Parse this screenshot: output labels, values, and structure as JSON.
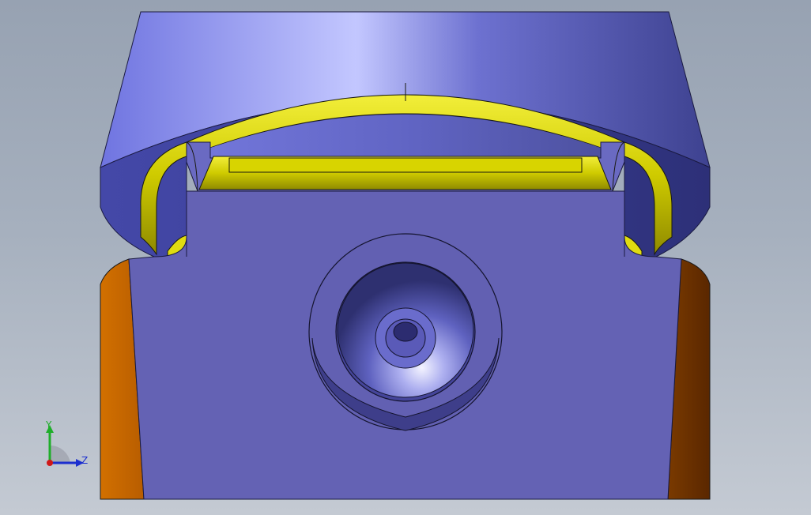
{
  "viewport": {
    "background_top": "#97a2b2",
    "background_bottom": "#c4cad3"
  },
  "model": {
    "colors": {
      "cap_face": "#7f85e6",
      "cap_highlight": "#c4c8ff",
      "cap_dark": "#3f4390",
      "body_face": "#6462b4",
      "groove_yellow": "#d6d200",
      "left_side": "#c96700",
      "right_side": "#6b3000"
    },
    "icons": [
      "counterbore-hole",
      "groove-ring"
    ]
  },
  "triad": {
    "y_label": "Y",
    "z_label": "Z",
    "y_color": "#1fae2a",
    "z_color": "#1c2fcf",
    "x_color": "#d01818"
  }
}
